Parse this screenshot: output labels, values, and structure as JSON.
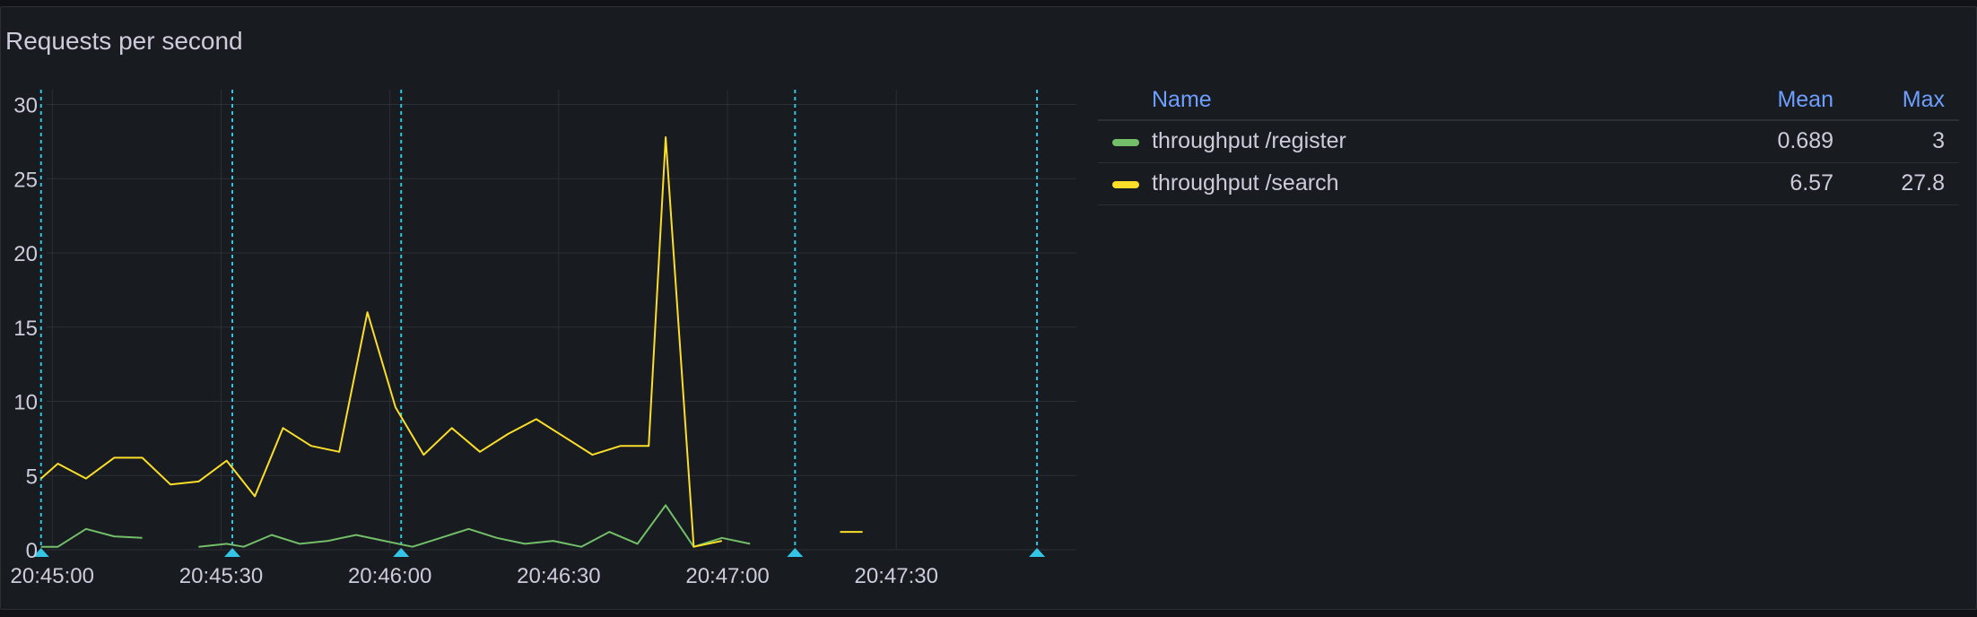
{
  "panel": {
    "title": "Requests per second"
  },
  "colors": {
    "background": "#181b1f",
    "grid": "#2c2f35",
    "axis_text": "#ccccdc",
    "annotation": "#33c4e6",
    "legend_header": "#6e9fff"
  },
  "legend": {
    "headers": {
      "name": "Name",
      "mean": "Mean",
      "max": "Max"
    },
    "rows": [
      {
        "name": "throughput /register",
        "mean": "0.689",
        "max": "3",
        "color": "#73bf69"
      },
      {
        "name": "throughput /search",
        "mean": "6.57",
        "max": "27.8",
        "color": "#fade2a"
      }
    ]
  },
  "chart_data": {
    "type": "line",
    "title": "Requests per second",
    "xlabel": "",
    "ylabel": "",
    "x_format": "HH:MM:SS",
    "xlim": [
      "20:44:59",
      "20:48:02"
    ],
    "ylim": [
      0,
      31
    ],
    "y_ticks": [
      0,
      5,
      10,
      15,
      20,
      25,
      30
    ],
    "y_tick_labels": [
      "0",
      "5",
      "10",
      "15",
      "20",
      "25",
      "30"
    ],
    "x_ticks": [
      "20:45:00",
      "20:45:30",
      "20:46:00",
      "20:46:30",
      "20:47:00",
      "20:47:30"
    ],
    "x_tick_labels": [
      "20:45:00",
      "20:45:30",
      "20:46:00",
      "20:46:30",
      "20:47:00",
      "20:47:30"
    ],
    "grid": true,
    "legend_position": "right",
    "annotations": [
      "20:44:58",
      "20:45:32",
      "20:46:02",
      "20:47:12",
      "20:47:55"
    ],
    "series": [
      {
        "name": "throughput /register",
        "color": "#73bf69",
        "segments": [
          [
            [
              "20:44:58",
              0.2
            ],
            [
              "20:45:01",
              0.2
            ],
            [
              "20:45:06",
              1.4
            ],
            [
              "20:45:11",
              0.9
            ],
            [
              "20:45:16",
              0.8
            ]
          ],
          [
            [
              "20:45:26",
              0.2
            ],
            [
              "20:45:31",
              0.4
            ],
            [
              "20:45:34",
              0.2
            ],
            [
              "20:45:39",
              1.0
            ],
            [
              "20:45:44",
              0.4
            ],
            [
              "20:45:49",
              0.6
            ],
            [
              "20:45:54",
              1.0
            ],
            [
              "20:45:59",
              0.6
            ],
            [
              "20:46:04",
              0.2
            ],
            [
              "20:46:09",
              0.8
            ],
            [
              "20:46:14",
              1.4
            ],
            [
              "20:46:19",
              0.8
            ],
            [
              "20:46:24",
              0.4
            ],
            [
              "20:46:29",
              0.6
            ],
            [
              "20:46:34",
              0.2
            ],
            [
              "20:46:39",
              1.2
            ],
            [
              "20:46:44",
              0.4
            ],
            [
              "20:46:49",
              3.0
            ],
            [
              "20:46:54",
              0.2
            ],
            [
              "20:46:59",
              0.8
            ],
            [
              "20:47:04",
              0.4
            ]
          ]
        ]
      },
      {
        "name": "throughput /search",
        "color": "#fade2a",
        "segments": [
          [
            [
              "20:44:58",
              4.8
            ],
            [
              "20:45:01",
              5.8
            ],
            [
              "20:45:06",
              4.8
            ],
            [
              "20:45:11",
              6.2
            ],
            [
              "20:45:16",
              6.2
            ],
            [
              "20:45:21",
              4.4
            ],
            [
              "20:45:26",
              4.6
            ],
            [
              "20:45:31",
              6.0
            ],
            [
              "20:45:36",
              3.6
            ],
            [
              "20:45:41",
              8.2
            ],
            [
              "20:45:46",
              7.0
            ],
            [
              "20:45:51",
              6.6
            ],
            [
              "20:45:56",
              16.0
            ],
            [
              "20:46:01",
              9.6
            ],
            [
              "20:46:06",
              6.4
            ],
            [
              "20:46:11",
              8.2
            ],
            [
              "20:46:16",
              6.6
            ],
            [
              "20:46:21",
              7.8
            ],
            [
              "20:46:26",
              8.8
            ],
            [
              "20:46:31",
              7.6
            ],
            [
              "20:46:36",
              6.4
            ],
            [
              "20:46:41",
              7.0
            ],
            [
              "20:46:46",
              7.0
            ],
            [
              "20:46:49",
              27.8
            ],
            [
              "20:46:54",
              0.2
            ],
            [
              "20:46:59",
              0.6
            ]
          ],
          [
            [
              "20:47:20",
              1.2
            ],
            [
              "20:47:24",
              1.2
            ]
          ]
        ]
      }
    ]
  }
}
